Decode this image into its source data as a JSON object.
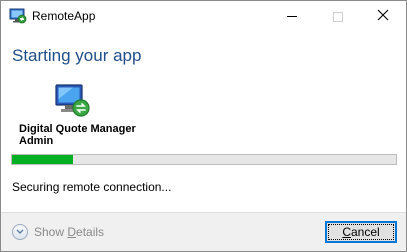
{
  "window": {
    "title": "RemoteApp",
    "controls": {
      "minimize": "minimize",
      "maximize": "maximize",
      "close": "close"
    }
  },
  "main": {
    "heading": "Starting your app",
    "program_name_line1": "Digital Quote Manager",
    "program_name_line2": "Admin",
    "progress_percent": 16,
    "status": "Securing remote connection..."
  },
  "footer": {
    "details_prefix": "Show ",
    "details_underlined": "D",
    "details_suffix": "etails",
    "cancel_underlined": "C",
    "cancel_suffix": "ancel"
  },
  "colors": {
    "heading": "#1e4e8c",
    "progress_fill": "#06b025",
    "accent_border": "#0078d7"
  },
  "icons": [
    "remoteapp-icon",
    "remote-program-icon",
    "chevron-down-icon",
    "minimize-icon",
    "maximize-icon",
    "close-icon"
  ]
}
